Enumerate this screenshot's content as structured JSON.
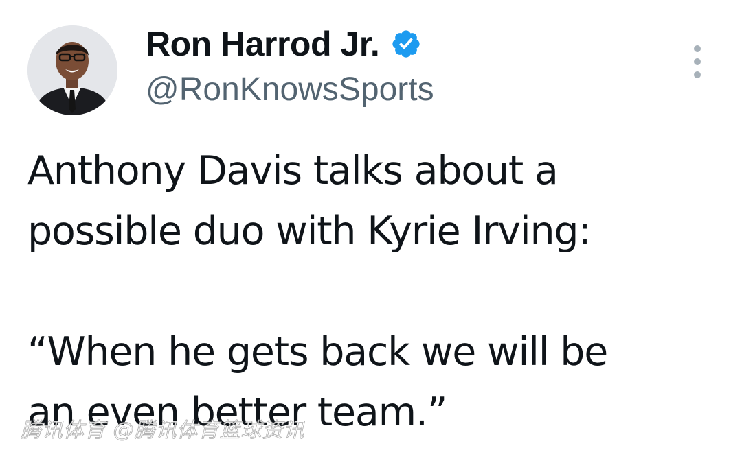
{
  "author": {
    "display_name": "Ron Harrod Jr.",
    "handle": "@RonKnowsSports",
    "verified": true,
    "verified_color": "#1d9bf0"
  },
  "menu": {
    "icon": "more-vertical-icon"
  },
  "tweet": {
    "lines": [
      "Anthony Davis talks about a",
      "possible duo with Kyrie Irving:",
      "",
      "“When he gets back we will be",
      "an even better team.”"
    ]
  },
  "watermark": {
    "text": "腾讯体育 @腾讯体育篮球资讯"
  },
  "colors": {
    "text": "#0f1419",
    "secondary_text": "#536471",
    "background": "#ffffff"
  }
}
